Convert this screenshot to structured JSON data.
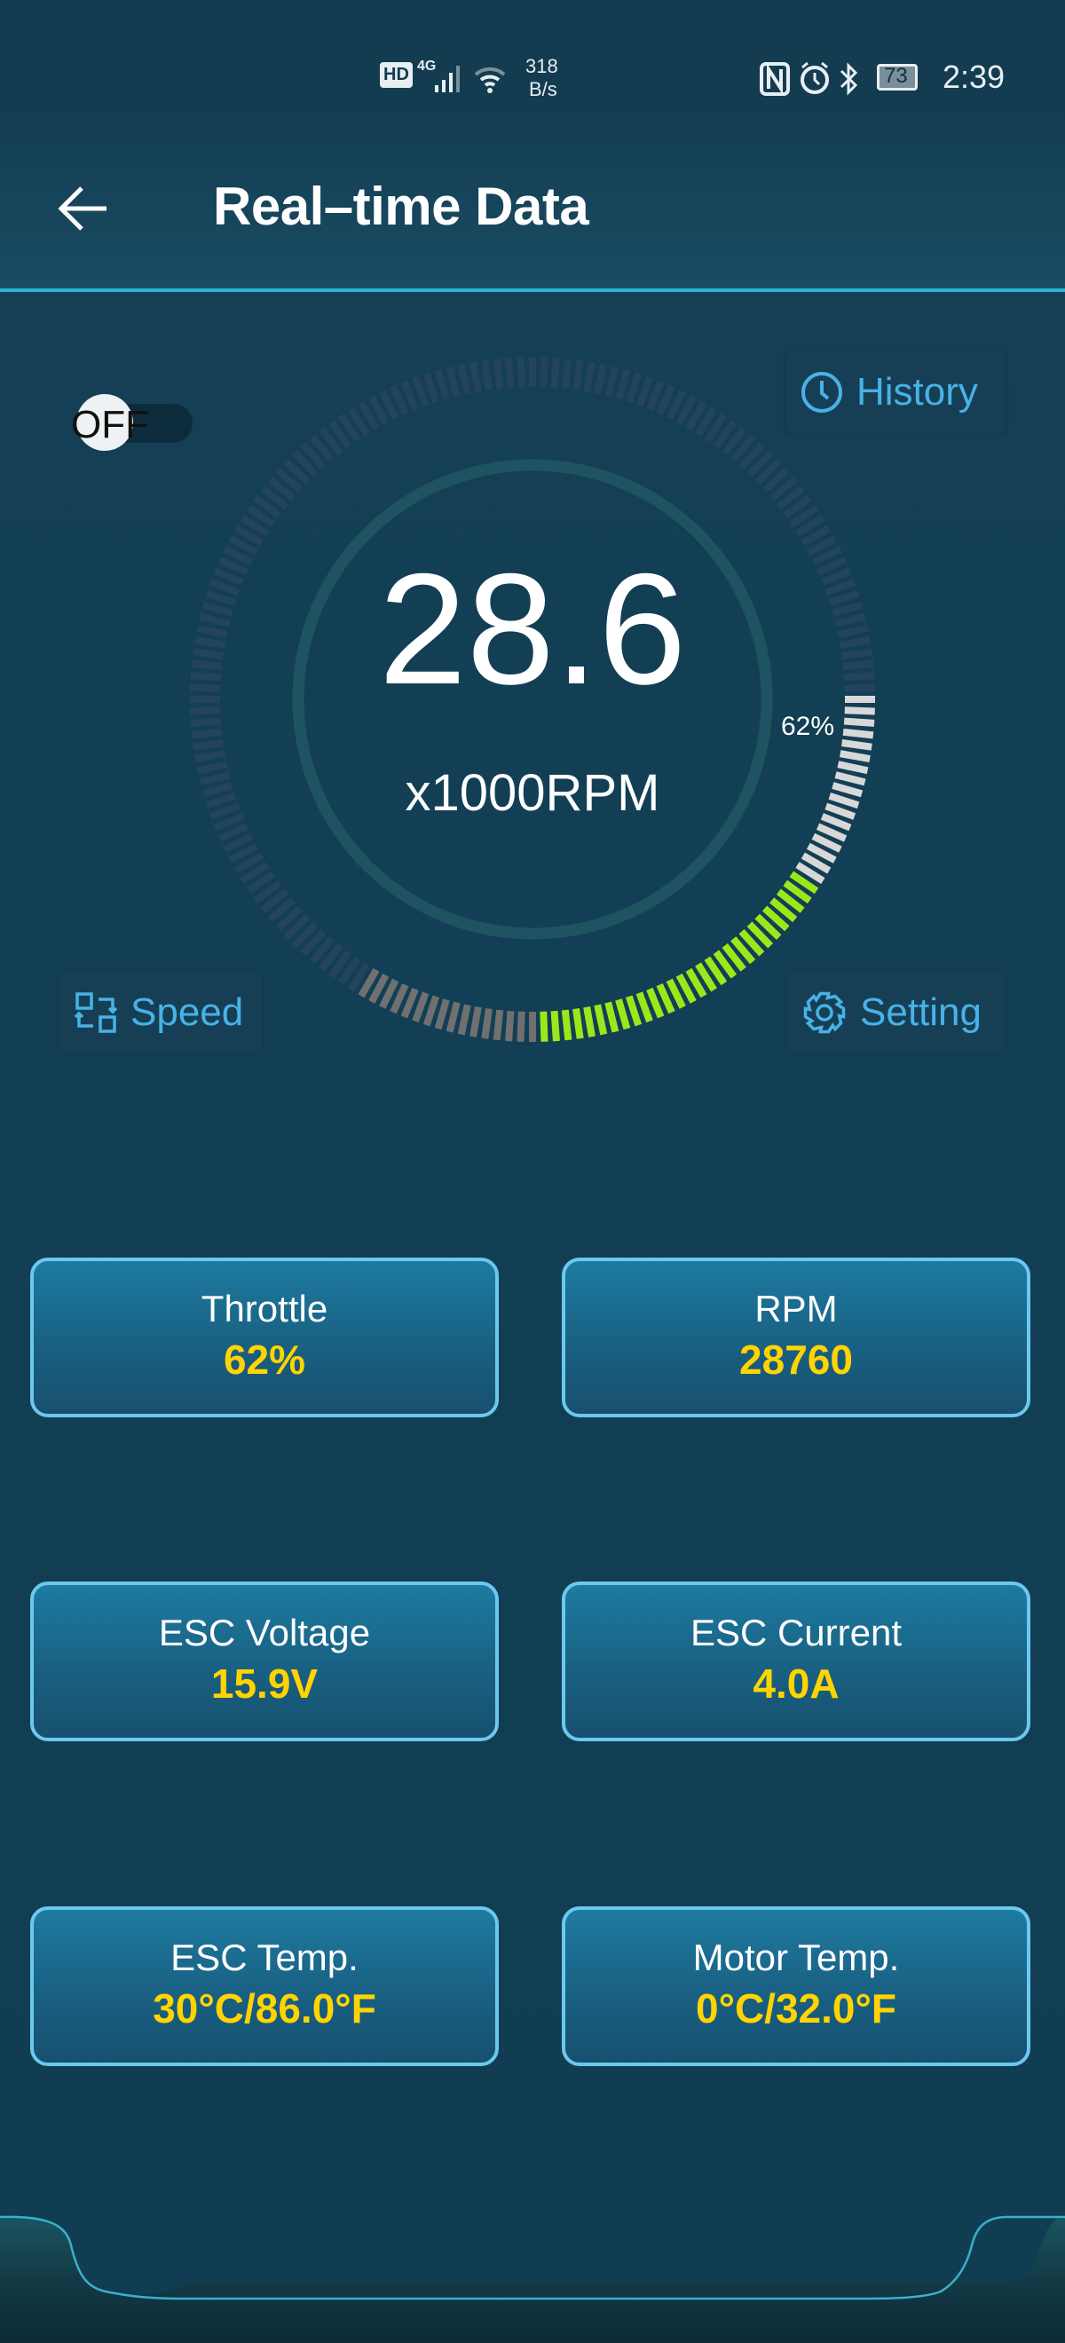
{
  "status_bar": {
    "net_speed_value": "318",
    "net_speed_unit": "B/s",
    "network": "4G",
    "hd": "HD",
    "battery": "73",
    "time": "2:39",
    "icons": [
      "hd-icon",
      "signal-icon",
      "wifi-icon",
      "nfc-icon",
      "alarm-icon",
      "bluetooth-icon",
      "battery-icon"
    ]
  },
  "header": {
    "title": "Real–time Data",
    "back_icon": "arrow-left-icon"
  },
  "toggle": {
    "label": "OFF",
    "state": false
  },
  "buttons": {
    "history": "History",
    "speed": "Speed",
    "setting": "Setting"
  },
  "gauge": {
    "value": "28.6",
    "unit": "x1000RPM",
    "throttle_label": "62%",
    "throttle_percent": 62,
    "colors": {
      "active": "#9be81a",
      "pending": "#d8d8d8",
      "base": "#707070",
      "inactive": "#24435e"
    }
  },
  "cards": [
    {
      "label": "Throttle",
      "value": "62%"
    },
    {
      "label": "RPM",
      "value": "28760"
    },
    {
      "label": "ESC Voltage",
      "value": "15.9V"
    },
    {
      "label": "ESC Current",
      "value": "4.0A"
    },
    {
      "label": "ESC Temp.",
      "value": "30°C/86.0°F"
    },
    {
      "label": "Motor Temp.",
      "value": "0°C/32.0°F"
    }
  ],
  "colors": {
    "accent": "#48b2e6",
    "value": "#ffd400",
    "card_border": "#6cc8ee",
    "header_line": "#27b4d6"
  }
}
